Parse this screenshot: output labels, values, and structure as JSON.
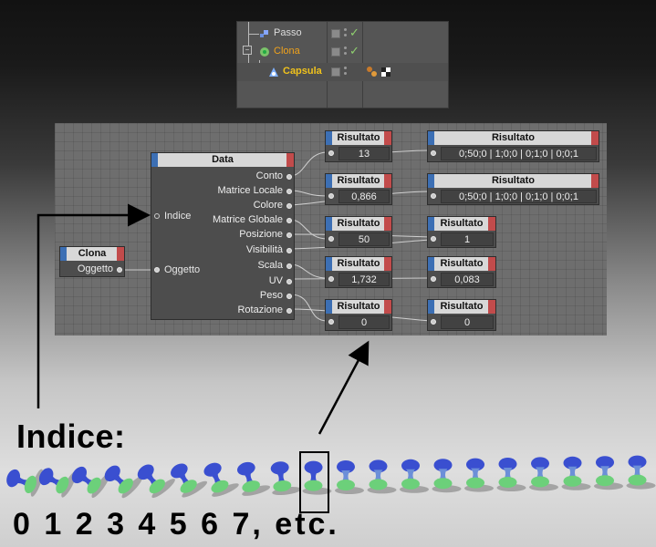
{
  "object_manager": {
    "rows": [
      {
        "name": "Passo",
        "color": "#dddddd"
      },
      {
        "name": "Clona",
        "color": "#f0a21c"
      },
      {
        "name": "Capsula",
        "color": "#f0c21c"
      }
    ]
  },
  "xpresso": {
    "clona_node": {
      "title": "Clona",
      "port": "Oggetto"
    },
    "data_node": {
      "title": "Data",
      "inputs": [
        "Indice",
        "Oggetto"
      ],
      "outputs": [
        "Conto",
        "Matrice Locale",
        "Colore",
        "Matrice Globale",
        "Posizione",
        "Visibilità",
        "Scala",
        "UV",
        "Peso",
        "Rotazione"
      ]
    },
    "result_nodes": [
      {
        "title": "Risultato",
        "value": "13"
      },
      {
        "title": "Risultato",
        "value": "0,866"
      },
      {
        "title": "Risultato",
        "value": "50"
      },
      {
        "title": "Risultato",
        "value": "1,732"
      },
      {
        "title": "Risultato",
        "value": "0"
      },
      {
        "title": "Risultato",
        "value": "0;50;0 | 1;0;0 | 0;1;0 | 0;0;1"
      },
      {
        "title": "Risultato",
        "value": "0;50;0 | 1;0;0 | 0;1;0 | 0;0;1"
      },
      {
        "title": "Risultato",
        "value": "1"
      },
      {
        "title": "Risultato",
        "value": "0,083"
      },
      {
        "title": "Risultato",
        "value": "0"
      }
    ]
  },
  "caption": {
    "title": "Indice:",
    "numbers": "0 1 2 3 4 5 6 7, etc."
  },
  "colors": {
    "port_blue": "#3c6fb4",
    "port_red": "#c24b4b",
    "clone_green": "#6cd07a",
    "clone_blue": "#3a4fd0"
  }
}
